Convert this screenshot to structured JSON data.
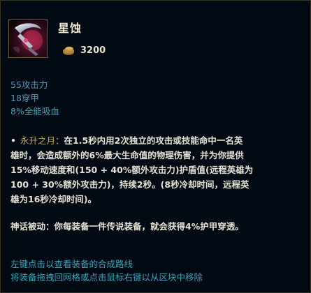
{
  "item": {
    "name": "星蚀",
    "gold": "3200",
    "icon": "eclipse-item-icon"
  },
  "stats": [
    "55攻击力",
    "18穿甲",
    "8%全能吸血"
  ],
  "passive": {
    "name": "永升之月：",
    "lines": [
      "在1.5秒内用2次独立的攻击或技能命中一名英",
      "雄时，会造成额外的6%最大生命值的物理伤害，并为你提供",
      "15%移动速度和(150 + 40%额外攻击力)护盾值(远程英雄为",
      "100 + 30%额外攻击力)，持续2秒。(8秒冷却时间，远程英",
      "雄为16秒冷却时间)。"
    ]
  },
  "mythic": "神话被动：你每装备一件传说装备，就会获得4%护甲穿透。",
  "hints": [
    "左键点击以查看装备的合成路线",
    "将装备拖拽回网格或点击鼠标右键以从区块中移除"
  ],
  "colors": {
    "background": "#010a13",
    "stat_text": "#4f9bb5",
    "passive_name": "#c9a85c",
    "hint_text": "#3aa3b8"
  }
}
